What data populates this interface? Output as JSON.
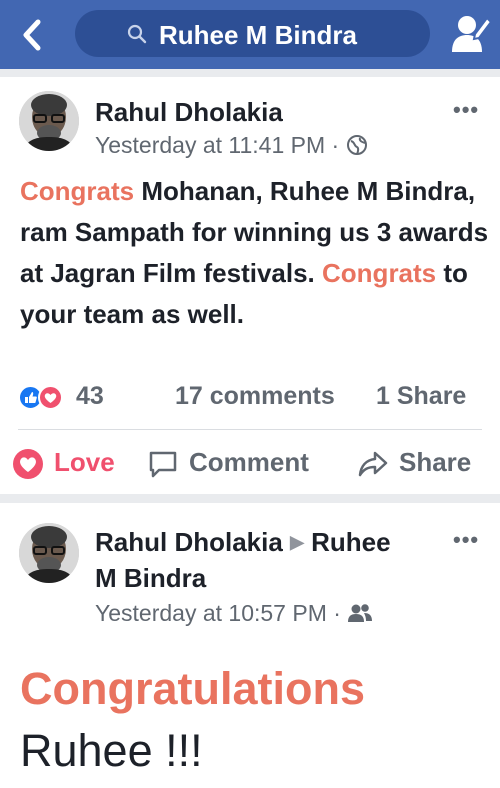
{
  "search": {
    "query": "Ruhee M Bindra"
  },
  "post1": {
    "author": "Rahul Dholakia",
    "time": "Yesterday at 11:41 PM",
    "separator": "·",
    "audience_icon": "globe-icon",
    "text_hl1": "Congrats",
    "text_1": " Mohanan, ",
    "text_b1": "Ruhee M Bindra",
    "text_2": ", ram Sampath for winning us 3 awards at Jagran Film festivals. ",
    "text_hl2": "Congrats",
    "text_3": " to your team as well.",
    "reaction_count": "43",
    "comments": "17 comments",
    "shares": "1 Share",
    "actions": {
      "love": "Love",
      "comment": "Comment",
      "share": "Share"
    }
  },
  "post2": {
    "author": "Rahul Dholakia",
    "arrow": "▶",
    "target_line1": "Ruhee",
    "target_line2": "M Bindra",
    "time": "Yesterday at 10:57 PM",
    "separator": "·",
    "audience_icon": "friends-icon",
    "big_line1": "Congratulations",
    "big_line2": "Ruhee !!!"
  },
  "menu_dots": "•••",
  "colors": {
    "header": "#4267b2",
    "search_bg": "#2d4f95",
    "highlight": "#e9735f",
    "love": "#f0506e",
    "like": "#1877f2"
  }
}
